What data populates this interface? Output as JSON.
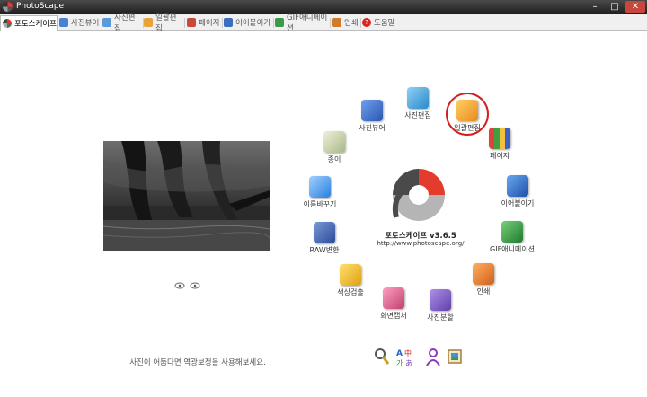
{
  "window": {
    "title": "PhotoScape",
    "controls": {
      "minimize": "–",
      "maximize": "□",
      "close": "✕"
    }
  },
  "tabs": [
    {
      "label": "포토스케이프",
      "icon": "photoscape-logo-icon",
      "color": "#e23a2c",
      "active": true
    },
    {
      "label": "사진뷰어",
      "icon": "photo-viewer-icon",
      "color": "#4a7fd6",
      "active": false
    },
    {
      "label": "사진편집",
      "icon": "photo-editor-icon",
      "color": "#5a9ad8",
      "active": false
    },
    {
      "label": "일괄편집",
      "icon": "batch-editor-icon",
      "color": "#e9a23a",
      "active": false
    },
    {
      "label": "페이지",
      "icon": "page-icon",
      "color": "#c94a3a",
      "active": false
    },
    {
      "label": "이어붙이기",
      "icon": "combine-icon",
      "color": "#3a6fbf",
      "active": false
    },
    {
      "label": "GIF애니메이션",
      "icon": "gif-animation-icon",
      "color": "#3a9a4a",
      "active": false
    },
    {
      "label": "인쇄",
      "icon": "print-icon",
      "color": "#d07a2a",
      "active": false
    },
    {
      "label": "도움말",
      "icon": "help-icon",
      "color": "#d22",
      "active": false
    }
  ],
  "launcher": {
    "items": [
      {
        "label": "사진뷰어",
        "icon": "photo-viewer-icon",
        "color": "#4b79d0"
      },
      {
        "label": "사진편집",
        "icon": "photo-editor-icon",
        "color": "#3aa0d8"
      },
      {
        "label": "일괄편집",
        "icon": "batch-editor-icon",
        "color": "#f0a030"
      },
      {
        "label": "페이지",
        "icon": "page-icon",
        "color": "#c83a3a"
      },
      {
        "label": "이어붙이기",
        "icon": "combine-icon",
        "color": "#2a66c0"
      },
      {
        "label": "GIF애니메이션",
        "icon": "gif-animation-icon",
        "color": "#2f9a3f"
      },
      {
        "label": "인쇄",
        "icon": "print-icon",
        "color": "#f08020"
      },
      {
        "label": "사진분할",
        "icon": "splitter-icon",
        "color": "#8060c0"
      },
      {
        "label": "화면캡처",
        "icon": "screen-capture-icon",
        "color": "#e05a8a"
      },
      {
        "label": "색상검출",
        "icon": "color-picker-icon",
        "color": "#e8b020"
      },
      {
        "label": "RAW변환",
        "icon": "raw-converter-icon",
        "color": "#3a5fb0"
      },
      {
        "label": "이름바꾸기",
        "icon": "rename-icon",
        "color": "#4090e0"
      },
      {
        "label": "종이",
        "icon": "paper-print-icon",
        "color": "#8aa06a"
      }
    ],
    "version": "포토스케이프 v3.6.5",
    "url": "http://www.photoscape.org/",
    "highlighted": "일괄편집"
  },
  "bottom": {
    "tip": "사진이 어둡다면 역광보정을 사용해보세요."
  },
  "colors": {
    "accent": "#d51f1f",
    "logo_red": "#e43b2c",
    "logo_dark": "#4a4a4a",
    "logo_gray": "#b5b5b5"
  }
}
